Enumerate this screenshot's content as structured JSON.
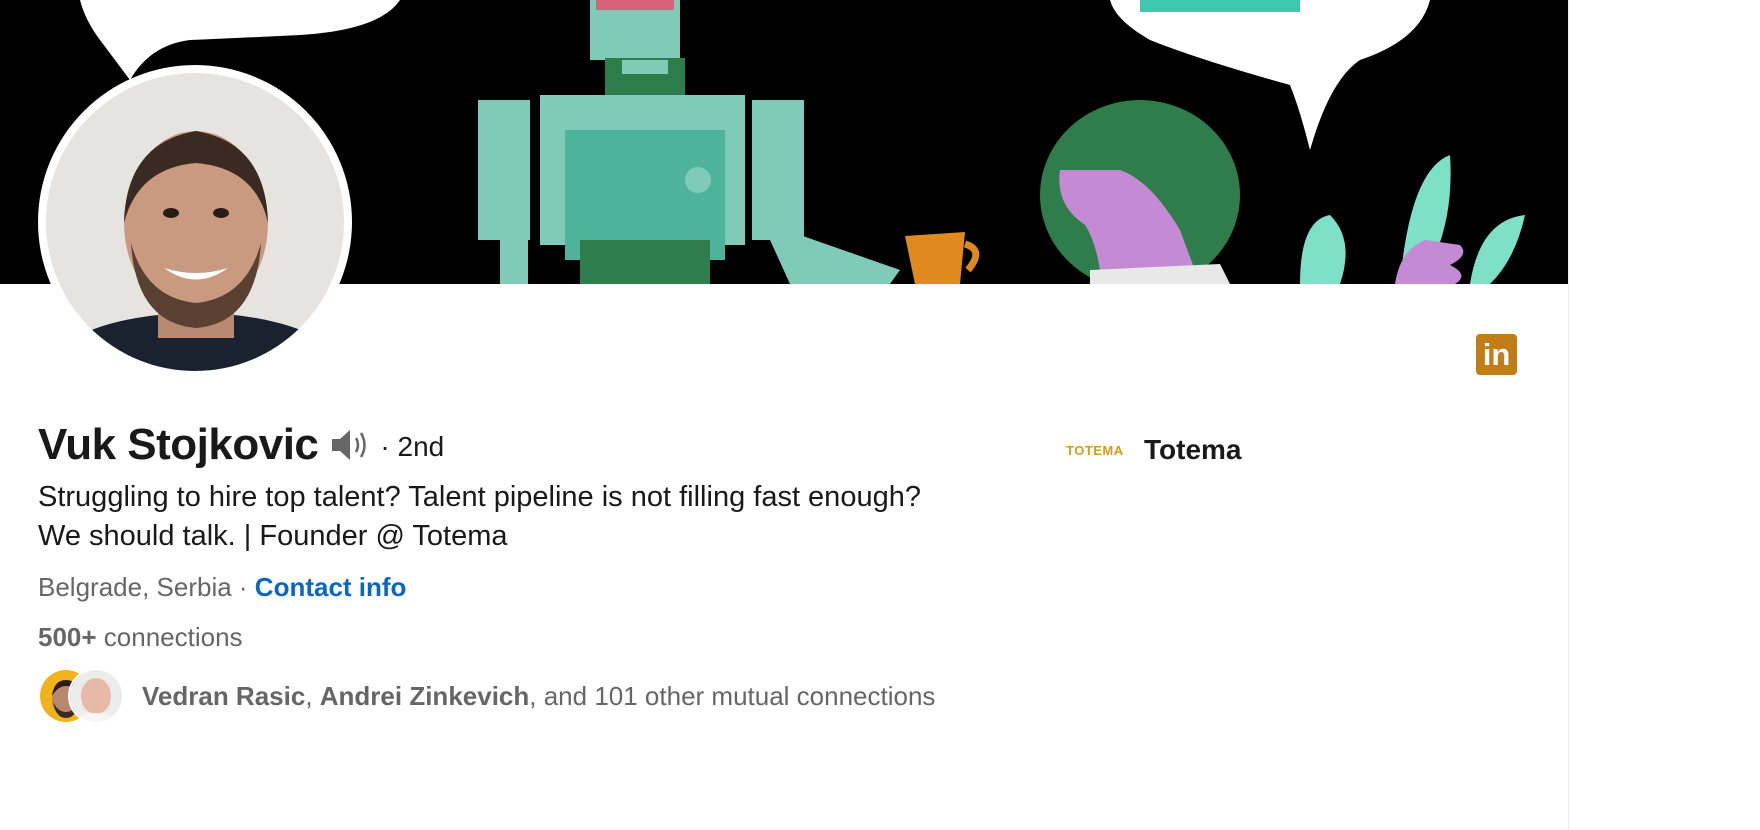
{
  "profile": {
    "name": "Vuk Stojkovic",
    "degree": "· 2nd",
    "headline_line1": "Struggling to hire top talent? Talent pipeline is not filling fast enough?",
    "headline_line2": "We should talk. | Founder @ Totema",
    "location": "Belgrade, Serbia",
    "location_sep": " · ",
    "contact_label": "Contact info",
    "connections_count": "500+",
    "connections_label": " connections",
    "mutual": {
      "name1": "Vedran Rasic",
      "sep": ", ",
      "name2": "Andrei Zinkevich",
      "rest": ", and 101 other mutual connections"
    }
  },
  "company": {
    "logo_text": "TOTEMA",
    "name": "Totema"
  },
  "badge": {
    "label": "in",
    "color": "#c37d16"
  },
  "colors": {
    "link": "#0a66c2",
    "muted": "#666666"
  },
  "icons": [
    "speaker-icon",
    "linkedin-icon"
  ]
}
